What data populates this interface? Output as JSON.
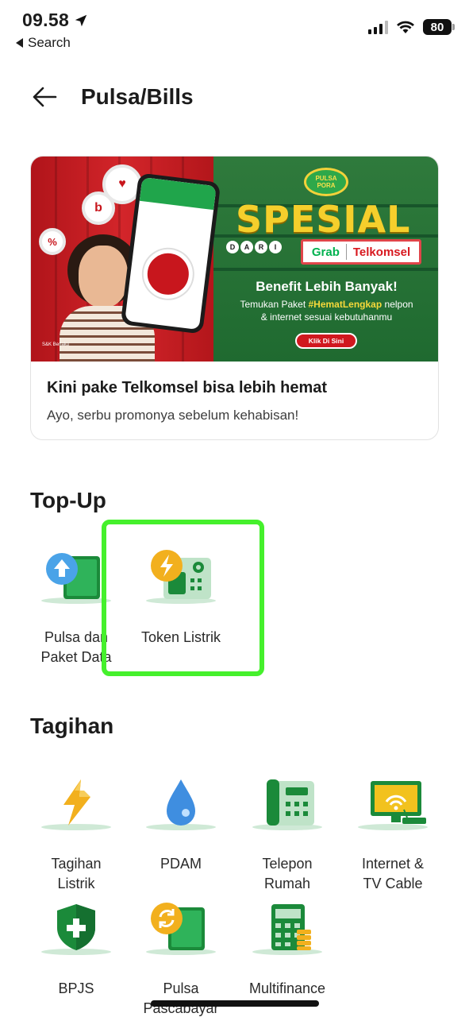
{
  "status_bar": {
    "time": "09.58",
    "back_app": "Search",
    "battery": "80"
  },
  "header": {
    "title": "Pulsa/Bills"
  },
  "promo": {
    "banner": {
      "badge_line1": "PULSA",
      "badge_line2": "PORA",
      "headline": "SPESIAL",
      "dari": [
        "D",
        "A",
        "R",
        "I"
      ],
      "brand1": "Grab",
      "brand2": "Telkomsel",
      "benefit_title": "Benefit Lebih Banyak!",
      "benefit_text_1": "Temukan Paket ",
      "benefit_hashtag": "#HematLengkap",
      "benefit_text_2": " nelpon",
      "benefit_text_3": "& internet sesuai kebutuhanmu",
      "cta": "Klik Di Sini",
      "fine_print": "S&K Berlaku"
    },
    "title": "Kini pake Telkomsel bisa lebih hemat",
    "subtitle": "Ayo, serbu promonya sebelum kehabisan!"
  },
  "topup": {
    "title": "Top-Up",
    "items": [
      {
        "label_1": "Pulsa dan",
        "label_2": "Paket Data",
        "icon": "phone-topup-icon"
      },
      {
        "label_1": "Token Listrik",
        "label_2": "",
        "icon": "electric-token-icon"
      }
    ]
  },
  "tagihan": {
    "title": "Tagihan",
    "items": [
      {
        "label_1": "Tagihan",
        "label_2": "Listrik",
        "icon": "lightning-icon"
      },
      {
        "label_1": "PDAM",
        "label_2": "",
        "icon": "water-drop-icon"
      },
      {
        "label_1": "Telepon",
        "label_2": "Rumah",
        "icon": "home-phone-icon"
      },
      {
        "label_1": "Internet &",
        "label_2": "TV Cable",
        "icon": "tv-wifi-icon"
      },
      {
        "label_1": "BPJS",
        "label_2": "",
        "icon": "health-shield-icon"
      },
      {
        "label_1": "Pulsa",
        "label_2": "Pascabayar",
        "icon": "postpaid-phone-icon"
      },
      {
        "label_1": "Multifinance",
        "label_2": "",
        "icon": "calculator-icon"
      }
    ]
  },
  "colors": {
    "accent_green": "#00b14f",
    "highlight": "#45f02c",
    "telkomsel_red": "#d8181f"
  }
}
